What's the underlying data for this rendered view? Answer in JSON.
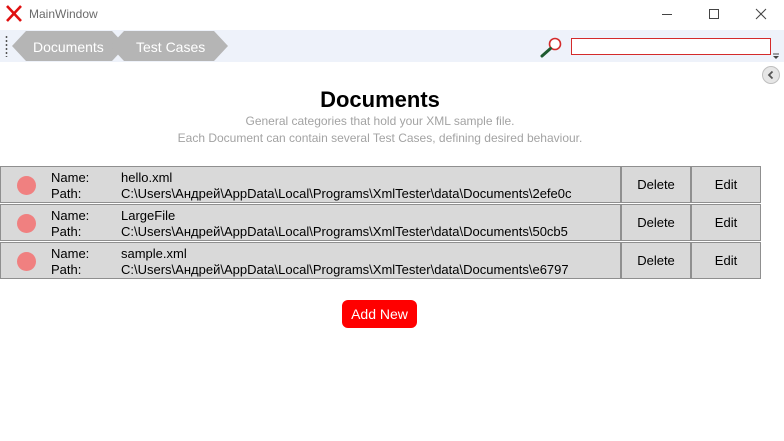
{
  "window": {
    "title": "MainWindow"
  },
  "toolbar": {
    "breadcrumbs": [
      {
        "label": "Documents"
      },
      {
        "label": "Test Cases"
      }
    ],
    "search": {
      "value": "",
      "placeholder": ""
    },
    "search_icon": "search-icon"
  },
  "colors": {
    "breadcrumb_fill": "#b5b5b5",
    "toolbar_bg": "#eef2fa",
    "accent_red": "#ff0000",
    "status_dot": "#f08080",
    "row_bg": "#d9d9d9"
  },
  "main": {
    "title": "Documents",
    "subtitle_lines": [
      "General categories that hold your XML sample file.",
      "Each Document can contain several Test Cases, defining desired behaviour."
    ],
    "field_labels": {
      "name": "Name:",
      "path": "Path:"
    },
    "documents": [
      {
        "name": "hello.xml",
        "path": "C:\\Users\\Андрей\\AppData\\Local\\Programs\\XmlTester\\data\\Documents\\2efe0c",
        "delete_label": "Delete",
        "edit_label": "Edit"
      },
      {
        "name": "LargeFile",
        "path": "C:\\Users\\Андрей\\AppData\\Local\\Programs\\XmlTester\\data\\Documents\\50cb5",
        "delete_label": "Delete",
        "edit_label": "Edit"
      },
      {
        "name": "sample.xml",
        "path": "C:\\Users\\Андрей\\AppData\\Local\\Programs\\XmlTester\\data\\Documents\\e6797",
        "delete_label": "Delete",
        "edit_label": "Edit"
      }
    ],
    "add_new_label": "Add New"
  }
}
